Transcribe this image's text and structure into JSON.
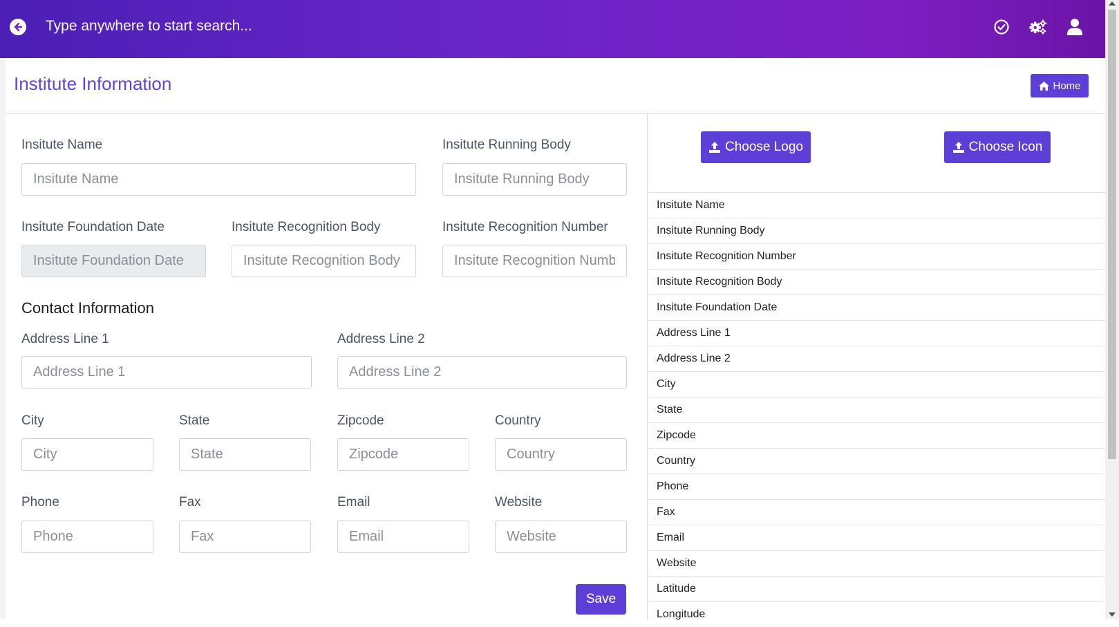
{
  "topbar": {
    "search_text": "Type anywhere to start search...",
    "icons": [
      "arrow-left-icon",
      "check-circle-icon",
      "gears-icon",
      "user-icon"
    ]
  },
  "page": {
    "title": "Institute Information",
    "home_label": "Home"
  },
  "form": {
    "institute_name": {
      "label": "Insitute Name",
      "placeholder": "Insitute Name"
    },
    "running_body": {
      "label": "Insitute Running Body",
      "placeholder": "Insitute Running Body"
    },
    "foundation_date": {
      "label": "Insitute Foundation Date",
      "placeholder": "Insitute Foundation Date"
    },
    "recognition_body": {
      "label": "Insitute Recognition Body",
      "placeholder": "Insitute Recognition Body"
    },
    "recognition_number": {
      "label": "Insitute Recognition Number",
      "placeholder": "Insitute Recognition Number"
    },
    "contact_title": "Contact Information",
    "address1": {
      "label": "Address Line 1",
      "placeholder": "Address Line 1"
    },
    "address2": {
      "label": "Address Line 2",
      "placeholder": "Address Line 2"
    },
    "city": {
      "label": "City",
      "placeholder": "City"
    },
    "state": {
      "label": "State",
      "placeholder": "State"
    },
    "zipcode": {
      "label": "Zipcode",
      "placeholder": "Zipcode"
    },
    "country": {
      "label": "Country",
      "placeholder": "Country"
    },
    "phone": {
      "label": "Phone",
      "placeholder": "Phone"
    },
    "fax": {
      "label": "Fax",
      "placeholder": "Fax"
    },
    "email": {
      "label": "Email",
      "placeholder": "Email"
    },
    "website": {
      "label": "Website",
      "placeholder": "Website"
    },
    "save_label": "Save"
  },
  "side_panel": {
    "choose_logo_label": "Choose Logo",
    "choose_icon_label": "Choose Icon",
    "fields": [
      "Insitute Name",
      "Insitute Running Body",
      "Insitute Recognition Number",
      "Insitute Recognition Body",
      "Insitute Foundation Date",
      "Address Line 1",
      "Address Line 2",
      "City",
      "State",
      "Zipcode",
      "Country",
      "Phone",
      "Fax",
      "Email",
      "Website",
      "Latitude",
      "Longitude"
    ]
  },
  "colors": {
    "accent": "#5b3fd6",
    "title": "#6245d8",
    "topbar_start": "#4b1fb6",
    "topbar_end": "#7d1fc3"
  }
}
